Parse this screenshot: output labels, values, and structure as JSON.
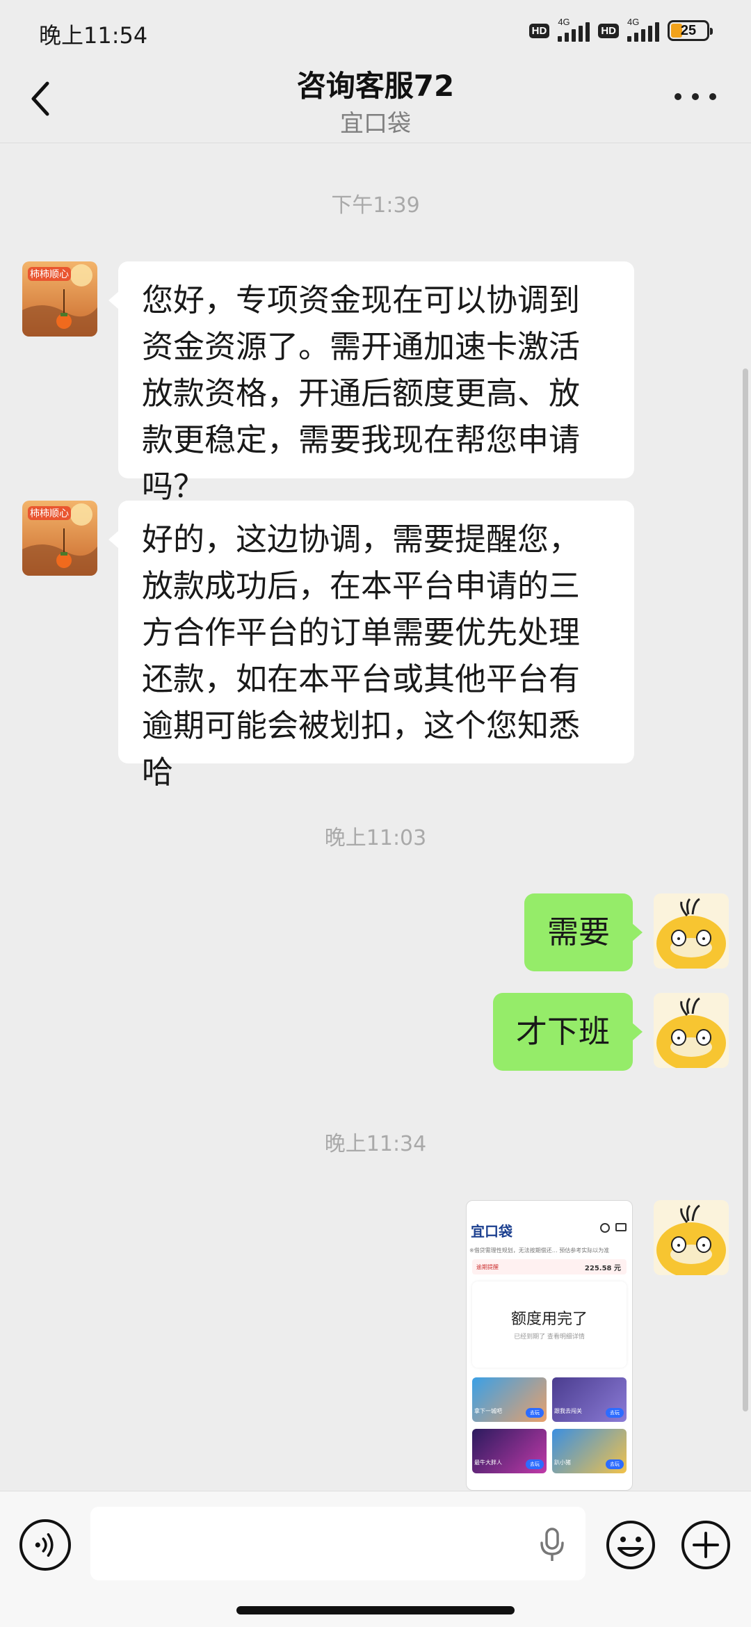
{
  "status_bar": {
    "time": "晚上11:54",
    "hd_badge": "HD",
    "network": "4G",
    "battery": "25"
  },
  "header": {
    "title": "咨询客服72",
    "subtitle": "宜口袋"
  },
  "messages": {
    "ts1": "下午1:39",
    "m1": "您好，专项资金现在可以协调到资金资源了。需开通加速卡激活放款资格，开通后额度更高、放款更稳定，需要我现在帮您申请吗？",
    "m2": "好的，这边协调，需要提醒您，放款成功后，在本平台申请的三方合作平台的订单需要优先处理还款，如在本平台或其他平台有逾期可能会被划扣，这个您知悉哈",
    "ts2": "晚上11:03",
    "m3": "需要",
    "m4": "才下班",
    "ts3": "晚上11:34"
  },
  "image_message": {
    "app_title": "宜口袋",
    "notice": "※借贷需理性规划，无法按期偿还…  预估参考实际以为准",
    "tip": "逾期提醒",
    "tip_amount": "225.58 元",
    "card_title": "额度用完了",
    "card_sub": "已经到期了  查看明细详情",
    "games": [
      {
        "label": "拿下一城吧",
        "btn": "去玩"
      },
      {
        "label": "跟我去闯关",
        "btn": "去玩"
      },
      {
        "label": "最牛大胖人",
        "btn": "去玩"
      },
      {
        "label": "趴小猪",
        "btn": "去玩"
      }
    ]
  },
  "colors": {
    "background": "#ededed",
    "incoming_bubble": "#ffffff",
    "outgoing_bubble": "#95ec69"
  }
}
